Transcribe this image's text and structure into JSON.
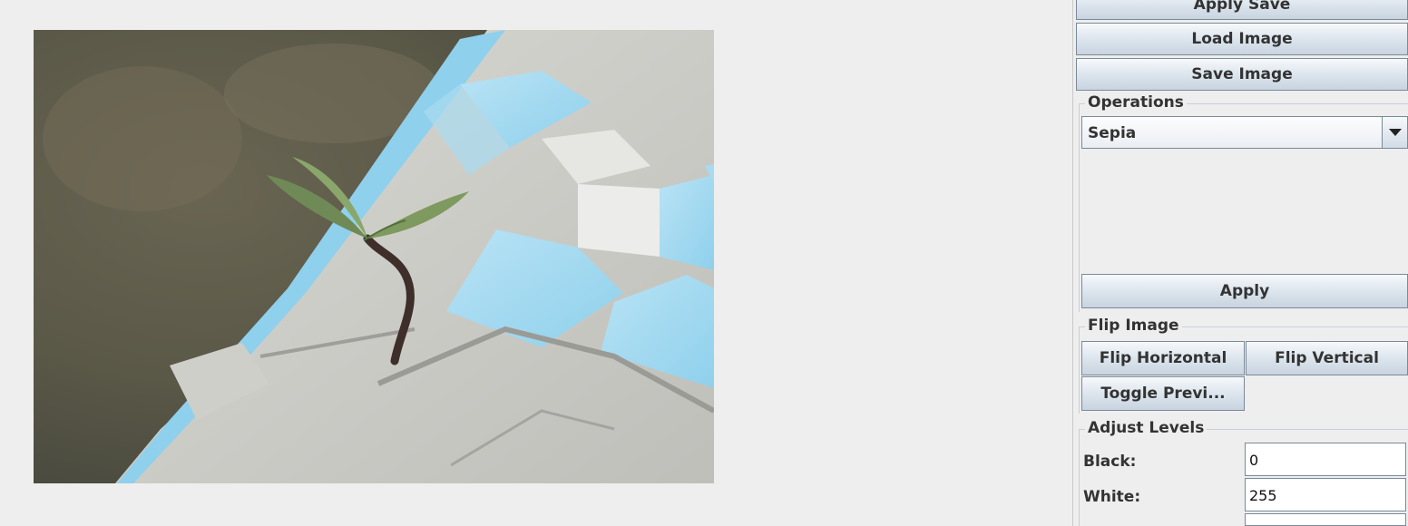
{
  "buttons": {
    "apply_save": "Apply Save",
    "load_image": "Load Image",
    "save_image": "Save Image",
    "apply": "Apply",
    "flip_horizontal": "Flip Horizontal",
    "flip_vertical": "Flip Vertical",
    "toggle_preview": "Toggle Previ..."
  },
  "operations": {
    "title": "Operations",
    "selected": "Sepia"
  },
  "flip_image": {
    "title": "Flip Image"
  },
  "adjust_levels": {
    "title": "Adjust Levels",
    "black_label": "Black:",
    "black_value": "0",
    "white_label": "White:",
    "white_value": "255",
    "mid_value": ""
  },
  "image": {
    "subject": "seedling-growing-from-tiled-wall-photo"
  }
}
